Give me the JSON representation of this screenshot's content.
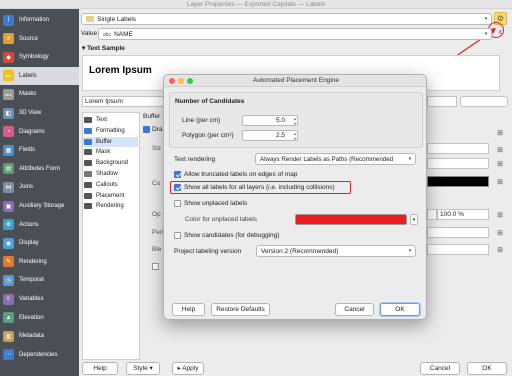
{
  "window": {
    "title": "Layer Properties — Exported Capitals — Labels"
  },
  "sidebar": {
    "items": [
      {
        "label": "Information",
        "icon": "info-icon",
        "color": "#3a7bd5"
      },
      {
        "label": "Source",
        "icon": "source-icon",
        "color": "#e0a030"
      },
      {
        "label": "Symbology",
        "icon": "symbology-icon",
        "color": "#d04b3a"
      },
      {
        "label": "Labels",
        "icon": "labels-icon",
        "color": "#f0c020",
        "active": true
      },
      {
        "label": "Masks",
        "icon": "masks-icon",
        "color": "#9a9a9a"
      },
      {
        "label": "3D View",
        "icon": "3d-view-icon",
        "color": "#6f8fb0"
      },
      {
        "label": "Diagrams",
        "icon": "diagrams-icon",
        "color": "#d65a8a"
      },
      {
        "label": "Fields",
        "icon": "fields-icon",
        "color": "#4a90c8"
      },
      {
        "label": "Attributes Form",
        "icon": "attributes-form-icon",
        "color": "#5aa06a"
      },
      {
        "label": "Joins",
        "icon": "joins-icon",
        "color": "#7d8fa0"
      },
      {
        "label": "Auxiliary Storage",
        "icon": "auxiliary-storage-icon",
        "color": "#8a6ab5"
      },
      {
        "label": "Actions",
        "icon": "actions-icon",
        "color": "#3aa0c8"
      },
      {
        "label": "Display",
        "icon": "display-icon",
        "color": "#4aa0d8"
      },
      {
        "label": "Rendering",
        "icon": "rendering-icon",
        "color": "#e07a30"
      },
      {
        "label": "Temporal",
        "icon": "temporal-icon",
        "color": "#5a9ad0"
      },
      {
        "label": "Variables",
        "icon": "variables-icon",
        "color": "#8a70b0"
      },
      {
        "label": "Elevation",
        "icon": "elevation-icon",
        "color": "#5aa080"
      },
      {
        "label": "Metadata",
        "icon": "metadata-icon",
        "color": "#c8a050"
      },
      {
        "label": "Dependencies",
        "icon": "dependencies-icon",
        "color": "#3a7bd5"
      }
    ]
  },
  "labels_mode": {
    "value": "Single Labels"
  },
  "value_row": {
    "label": "Value",
    "field": "NAME"
  },
  "text_sample": {
    "header": "Text Sample",
    "preview": "Lorem Ipsum",
    "input": "Lorem Ipsum"
  },
  "tree": {
    "items": [
      {
        "label": "Text",
        "color": "#555"
      },
      {
        "label": "Formatting",
        "color": "#3a7bd5"
      },
      {
        "label": "Buffer",
        "color": "#3a7bd5",
        "active": true
      },
      {
        "label": "Mask",
        "color": "#555"
      },
      {
        "label": "Background",
        "color": "#555"
      },
      {
        "label": "Shadow",
        "color": "#777"
      },
      {
        "label": "Callouts",
        "color": "#555"
      },
      {
        "label": "Placement",
        "color": "#555"
      },
      {
        "label": "Rendering",
        "color": "#555"
      }
    ]
  },
  "buffer_panel": {
    "heading": "Buffer",
    "draw_label": "Dra",
    "opacity_value": "100.0 %"
  },
  "bottom_bar": {
    "help": "Help",
    "style": "Style",
    "apply": "Apply",
    "cancel": "Cancel",
    "ok": "OK"
  },
  "dialog": {
    "title": "Automated Placement Engine",
    "section": "Number of Candidates",
    "line_label": "Line (per cm)",
    "line_value": "5.0",
    "polygon_label": "Polygon (per cm²)",
    "polygon_value": "2.5",
    "text_rendering_label": "Text rendering",
    "text_rendering_value": "Always Render Labels as Paths (Recommended",
    "allow_truncated": "Allow truncated labels on edges of map",
    "show_all_labels": "Show all labels for all layers (i.e. including collisions)",
    "show_unplaced": "Show unplaced labels",
    "color_unplaced_label": "Color for unplaced labels",
    "unplaced_color": "#ee1c1c",
    "show_candidates": "Show candidates (for debugging)",
    "version_label": "Project labeling version",
    "version_value": "Version 2 (Recommended)",
    "help": "Help",
    "restore": "Restore Defaults",
    "cancel": "Cancel",
    "ok": "OK"
  },
  "colors": {
    "highlight": "#e02020",
    "accent": "#3b78d8"
  }
}
